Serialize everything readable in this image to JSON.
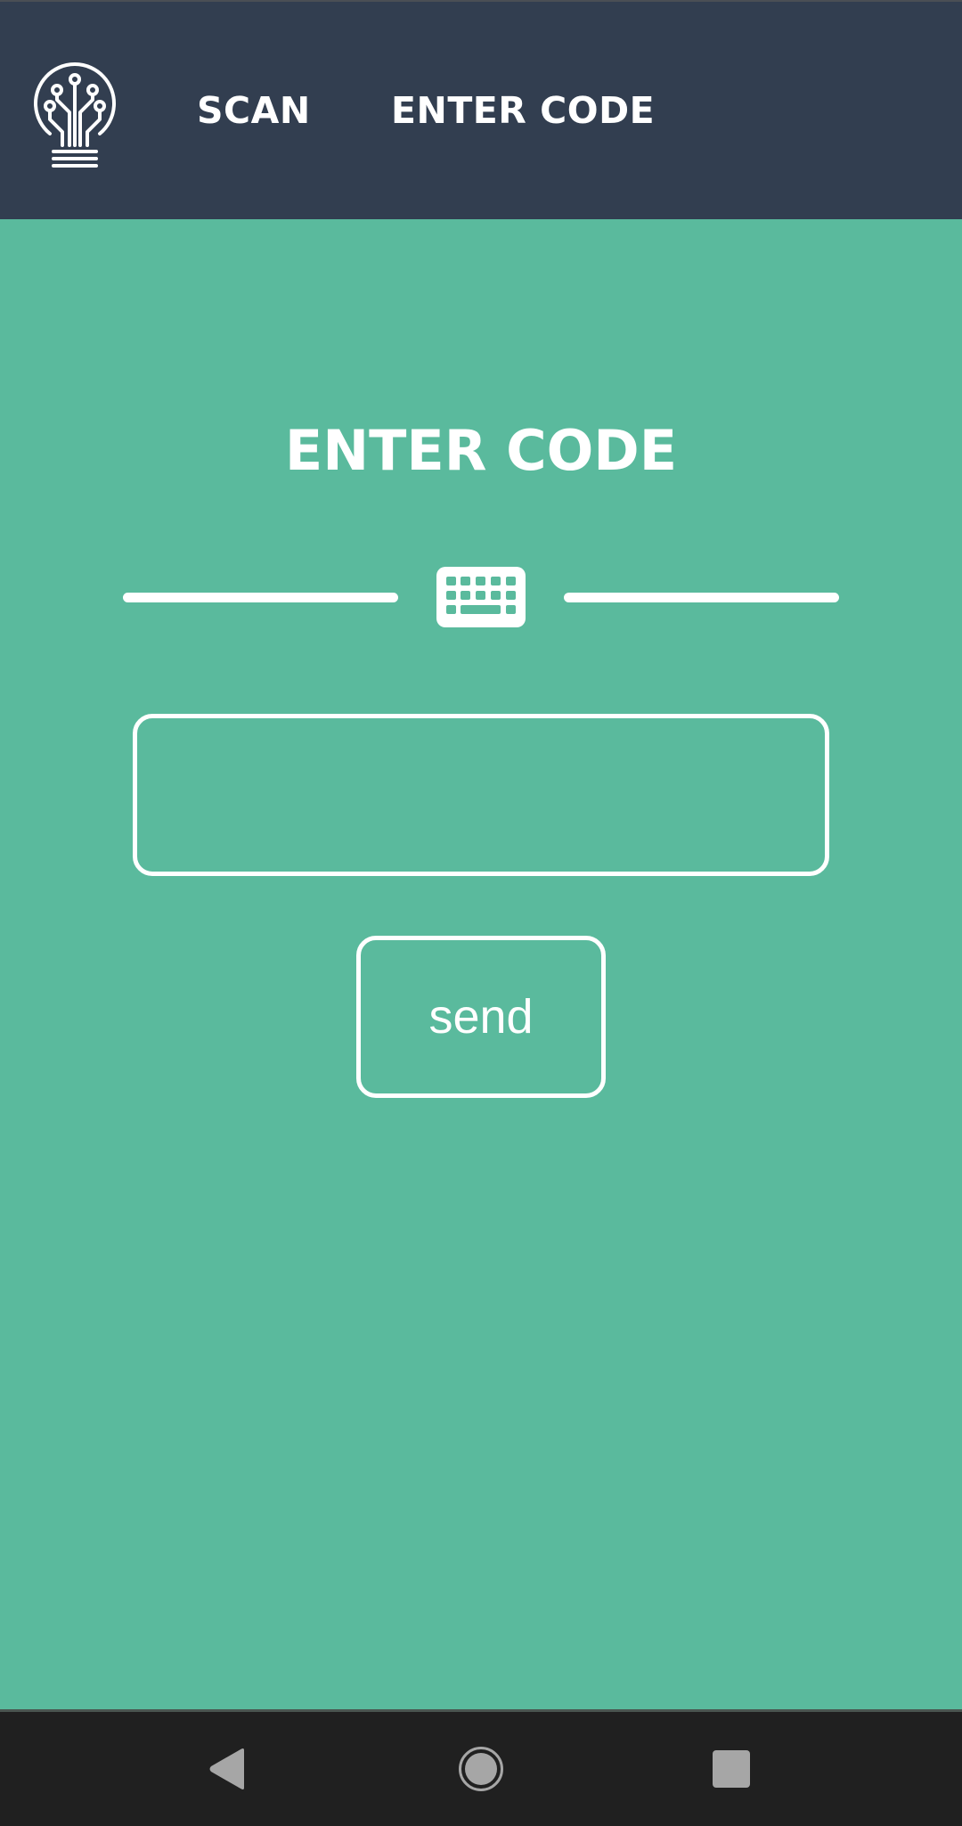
{
  "header": {
    "logo_icon": "circuit-lightbulb-icon",
    "nav": [
      {
        "label": "SCAN"
      },
      {
        "label": "ENTER CODE"
      }
    ]
  },
  "main": {
    "title": "ENTER CODE",
    "divider_icon": "keyboard-icon",
    "code_input": {
      "value": "",
      "placeholder": ""
    },
    "send_label": "send"
  },
  "system_nav": {
    "back_icon": "back-triangle-icon",
    "home_icon": "home-circle-icon",
    "recents_icon": "recents-square-icon"
  },
  "colors": {
    "header_background": "#323e50",
    "page_background": "#5aba9d",
    "foreground": "#ffffff",
    "system_nav_background": "#202020",
    "system_nav_icons": "#a6a6a6"
  }
}
